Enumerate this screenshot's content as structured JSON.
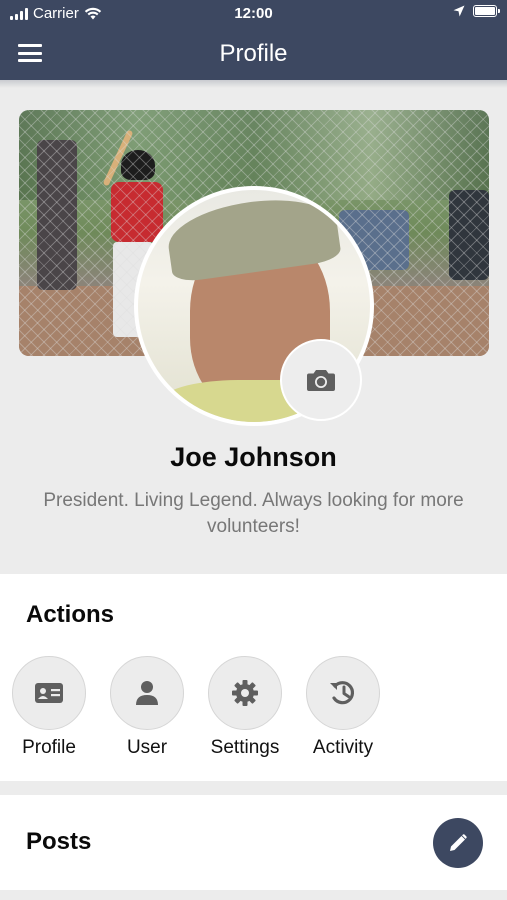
{
  "status_bar": {
    "carrier": "Carrier",
    "time": "12:00"
  },
  "nav": {
    "title": "Profile",
    "menu_icon": "hamburger-menu-icon"
  },
  "profile": {
    "name": "Joe Johnson",
    "bio": "President. Living Legend. Always looking for more volunteers!"
  },
  "actions": {
    "title": "Actions",
    "items": [
      {
        "label": "Profile",
        "icon": "id-card-icon"
      },
      {
        "label": "User",
        "icon": "user-icon"
      },
      {
        "label": "Settings",
        "icon": "gear-icon"
      },
      {
        "label": "Activity",
        "icon": "history-icon"
      }
    ]
  },
  "posts": {
    "title": "Posts",
    "edit_icon": "pencil-icon"
  },
  "colors": {
    "accent": "#3d4861",
    "background": "#ececec",
    "card": "#ffffff"
  }
}
